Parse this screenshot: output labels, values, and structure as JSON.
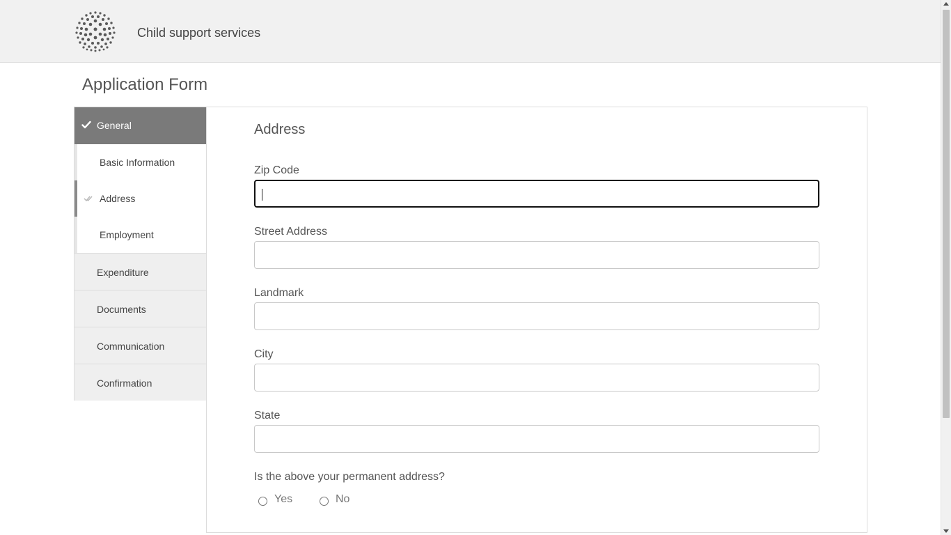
{
  "header": {
    "brand": "Child support services",
    "logo_icon": "dotted-sphere-logo"
  },
  "page": {
    "title": "Application Form"
  },
  "sidebar": {
    "general": {
      "label": "General",
      "icon": "check-icon"
    },
    "sub_items": [
      {
        "label": "Basic Information"
      },
      {
        "label": "Address",
        "icon": "double-check-icon"
      },
      {
        "label": "Employment"
      }
    ],
    "items": [
      {
        "label": "Expenditure"
      },
      {
        "label": "Documents"
      },
      {
        "label": "Communication"
      },
      {
        "label": "Confirmation"
      }
    ]
  },
  "form": {
    "section_title": "Address",
    "fields": [
      {
        "label": "Zip Code",
        "value": ""
      },
      {
        "label": "Street Address",
        "value": ""
      },
      {
        "label": "Landmark",
        "value": ""
      },
      {
        "label": "City",
        "value": ""
      },
      {
        "label": "State",
        "value": ""
      }
    ],
    "permanent_question": "Is the above your permanent address?",
    "options": [
      {
        "label": "Yes"
      },
      {
        "label": "No"
      }
    ]
  },
  "colors": {
    "header_bg": "#f1f1f1",
    "active_nav_bg": "#7a7a7a",
    "inactive_nav_bg": "#efefef"
  }
}
